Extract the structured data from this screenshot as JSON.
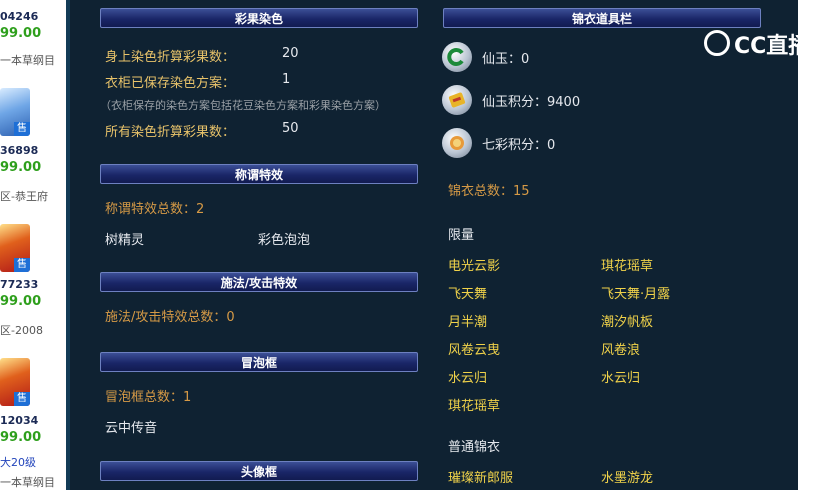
{
  "left_strip": {
    "items": [
      {
        "id": "04246",
        "price": "99.00",
        "sub": "一本草纲目",
        "avatar": "none"
      },
      {
        "id": "36898",
        "price": "99.00",
        "sub": "区-恭王府",
        "avatar": "blue"
      },
      {
        "id": "77233",
        "price": "99.00",
        "sub": "区-2008",
        "avatar": "red"
      },
      {
        "id": "12034",
        "price": "99.00",
        "sub": "大20级",
        "sub2": "一本草纲目",
        "avatar": "red"
      }
    ],
    "sale_label": "售"
  },
  "dye": {
    "header": "彩果染色",
    "rows": [
      {
        "label": "身上染色折算彩果数：",
        "value": "20"
      },
      {
        "label": "衣柜已保存染色方案：",
        "value": "1"
      }
    ],
    "note": "（衣柜保存的染色方案包括花豆染色方案和彩果染色方案）",
    "total_label": "所有染色折算彩果数：",
    "total_value": "50"
  },
  "title_effects": {
    "header": "称谓特效",
    "count_text": "称谓特效总数：2",
    "items": [
      "树精灵",
      "彩色泡泡"
    ]
  },
  "cast_effects": {
    "header": "施法/攻击特效",
    "count_text": "施法/攻击特效总数：0"
  },
  "bubble_frame": {
    "header": "冒泡框",
    "count_text": "冒泡框总数：1",
    "items": [
      "云中传音"
    ]
  },
  "avatar_frame": {
    "header": "头像框"
  },
  "wardrobe": {
    "header": "锦衣道具栏",
    "currencies": [
      {
        "label": "仙玉：0",
        "icon": "jade-icon"
      },
      {
        "label": "仙玉积分：9400",
        "icon": "jade-points-icon"
      },
      {
        "label": "七彩积分：0",
        "icon": "rainbow-points-icon"
      }
    ],
    "total_text": "锦衣总数：15",
    "limited_title": "限量",
    "limited_items": [
      "电光云影",
      "琪花瑶草",
      "飞天舞",
      "飞天舞·月露",
      "月半潮",
      "潮汐帆板",
      "风卷云曳",
      "风卷浪",
      "水云归",
      "水云归",
      "琪花瑶草"
    ],
    "normal_title": "普通锦衣",
    "normal_items": [
      "璀璨新郎服",
      "水墨游龙"
    ]
  },
  "watermark": {
    "text": "CC直播"
  }
}
